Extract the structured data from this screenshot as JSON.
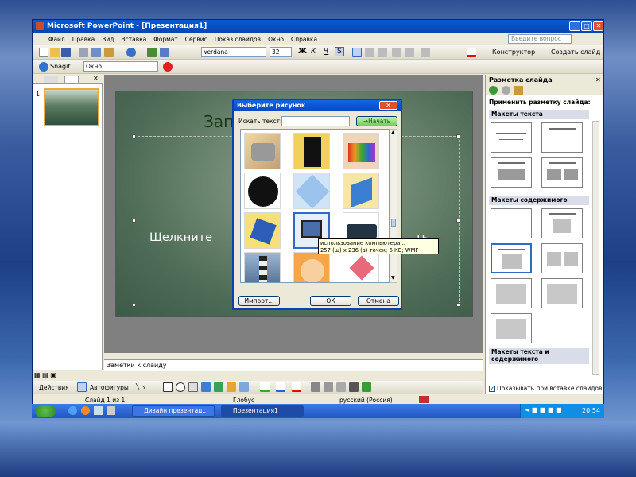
{
  "window": {
    "title": "Microsoft PowerPoint - [Презентация1]",
    "help_placeholder": "Введите вопрос"
  },
  "menu": [
    "Файл",
    "Правка",
    "Вид",
    "Вставка",
    "Формат",
    "Сервис",
    "Показ слайдов",
    "Окно",
    "Справка"
  ],
  "toolbar": {
    "font": "Verdana",
    "size": "32",
    "bold": "Ж",
    "italic": "К",
    "underline": "Ч",
    "shadow": "S",
    "designer": "Конструктор",
    "new_slide": "Создать слайд"
  },
  "toolbar2": {
    "snagit": "Snagit",
    "window_label": "Окно"
  },
  "outline": {
    "slide_number": "1"
  },
  "slide": {
    "title_fragment": "Зап",
    "body_left": "Щелкните",
    "body_right": "ть"
  },
  "notes": {
    "placeholder": "Заметки к слайду"
  },
  "dialog": {
    "title": "Выберите рисунок",
    "search_label": "Искать текст:",
    "search_value": "",
    "search_button": "Начать",
    "import_button": "Импорт...",
    "ok_button": "ОК",
    "cancel_button": "Отмена",
    "tooltip_line1": "использование компьютера...",
    "tooltip_line2": "257 (ш) x 236 (в) точек; 6 КБ; WMF"
  },
  "taskpane": {
    "title": "Разметка слайда",
    "apply_label": "Применить разметку слайда:",
    "sec_text": "Макеты текста",
    "sec_content": "Макеты содержимого",
    "sec_text_content": "Макеты текста и содержимого",
    "show_on_insert": "Показывать при вставке слайдов"
  },
  "drawbar": {
    "actions": "Действия",
    "autoshapes": "Автофигуры"
  },
  "status": {
    "slide": "Слайд 1 из 1",
    "design": "Глобус",
    "language": "русский (Россия)"
  },
  "taskbar": {
    "item1": "Дизайн презентац...",
    "item2": "Презентация1",
    "clock": "20:54"
  },
  "colors": {
    "title_bar": "#0a5bd6",
    "slide_bg": "#5d7a66",
    "task_section": "#d8dde9",
    "tooltip": "#ffffe1"
  }
}
